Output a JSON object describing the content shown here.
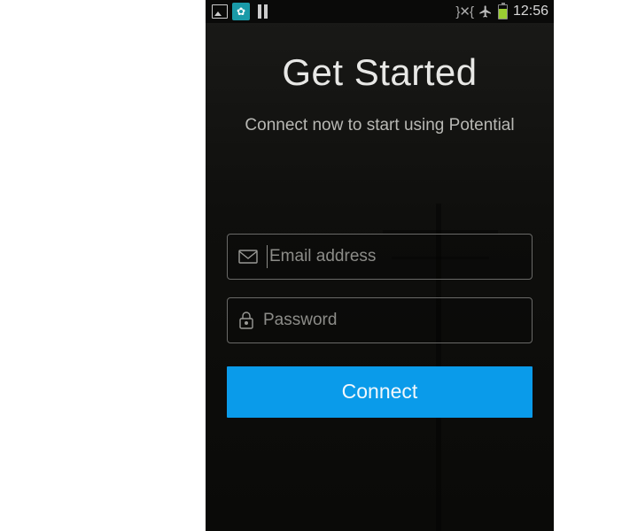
{
  "status_bar": {
    "clock": "12:56"
  },
  "screen": {
    "title": "Get Started",
    "subtitle": "Connect now to start using Potential"
  },
  "form": {
    "email_placeholder": "Email address",
    "password_placeholder": "Password",
    "connect_label": "Connect"
  },
  "colors": {
    "accent": "#0a9bea"
  }
}
